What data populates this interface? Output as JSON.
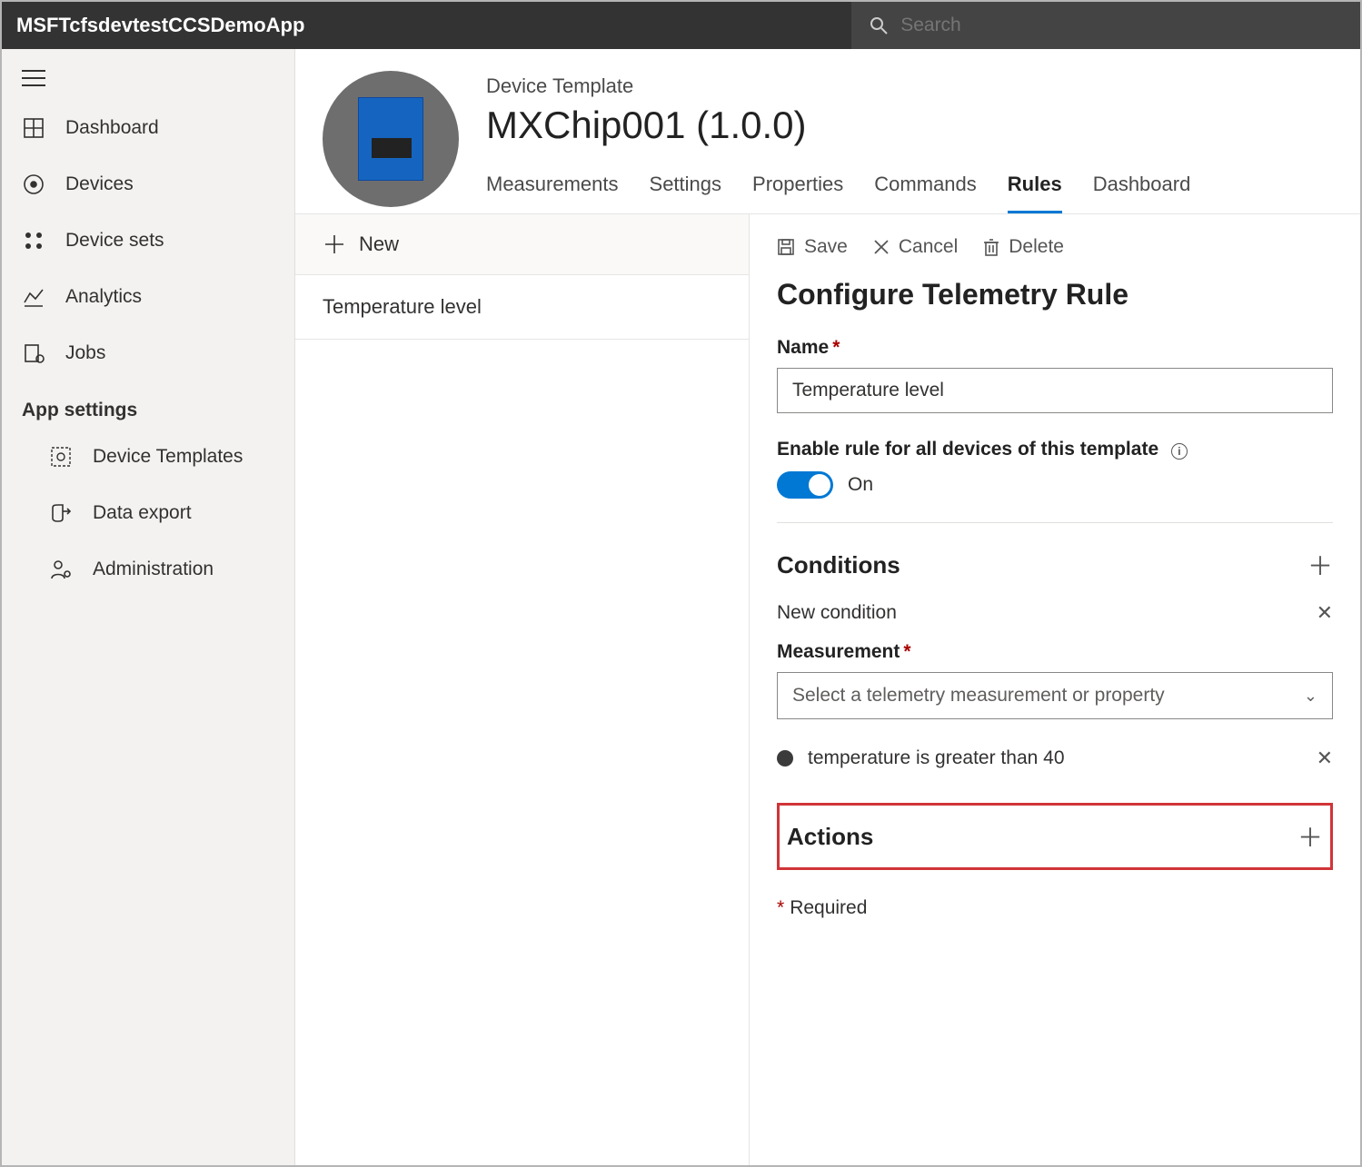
{
  "header": {
    "app_name": "MSFTcfsdevtestCCSDemoApp",
    "search_placeholder": "Search"
  },
  "sidebar": {
    "items": [
      {
        "label": "Dashboard"
      },
      {
        "label": "Devices"
      },
      {
        "label": "Device sets"
      },
      {
        "label": "Analytics"
      },
      {
        "label": "Jobs"
      }
    ],
    "section_label": "App settings",
    "settings": [
      {
        "label": "Device Templates"
      },
      {
        "label": "Data export"
      },
      {
        "label": "Administration"
      }
    ]
  },
  "template": {
    "breadcrumb": "Device Template",
    "title": "MXChip001  (1.0.0)",
    "tabs": [
      "Measurements",
      "Settings",
      "Properties",
      "Commands",
      "Rules",
      "Dashboard"
    ],
    "active_tab": "Rules"
  },
  "rules_list": {
    "new_label": "New",
    "items": [
      "Temperature level"
    ]
  },
  "detail": {
    "actions": {
      "save": "Save",
      "cancel": "Cancel",
      "delete": "Delete"
    },
    "panel_title": "Configure Telemetry Rule",
    "name_label": "Name",
    "name_value": "Temperature level",
    "enable_label": "Enable rule for all devices of this template",
    "toggle_state": "On",
    "conditions_label": "Conditions",
    "new_condition_label": "New condition",
    "measurement_label": "Measurement",
    "measurement_placeholder": "Select a telemetry measurement or property",
    "existing_condition": "temperature is greater than 40",
    "actions_label": "Actions",
    "required_note": "Required"
  }
}
